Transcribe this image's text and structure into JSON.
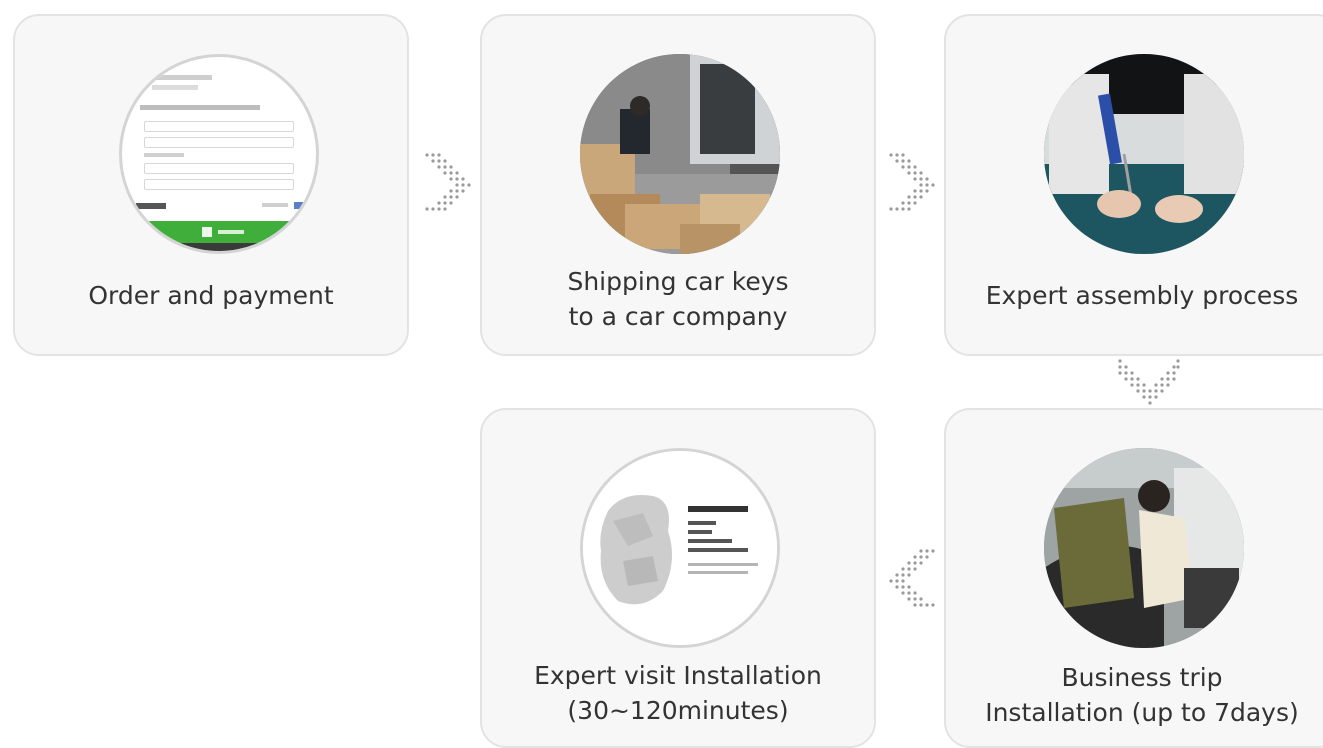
{
  "steps": [
    {
      "id": "order",
      "line1": "Order and payment",
      "line2": "",
      "image": "order-form-screenshot"
    },
    {
      "id": "shipping",
      "line1": "Shipping car keys",
      "line2": "to a car company",
      "image": "delivery-boxes-photo"
    },
    {
      "id": "assembly",
      "line1": "Expert assembly process",
      "line2": "",
      "image": "soldering-photo"
    },
    {
      "id": "trip",
      "line1": "Business trip",
      "line2": "Installation (up to 7days)",
      "image": "car-installation-photo"
    },
    {
      "id": "visit",
      "line1": "Expert visit Installation",
      "line2": "(30~120minutes)",
      "image": "korea-region-map"
    }
  ],
  "arrows": [
    "arrow-right-icon",
    "arrow-right-icon",
    "arrow-down-icon",
    "arrow-left-icon"
  ],
  "colors": {
    "card_bg": "#f6f7f6",
    "card_border": "#e2e4e2",
    "arrow_dots": "#9a9a9a",
    "order_button_green": "#3fae3a"
  }
}
